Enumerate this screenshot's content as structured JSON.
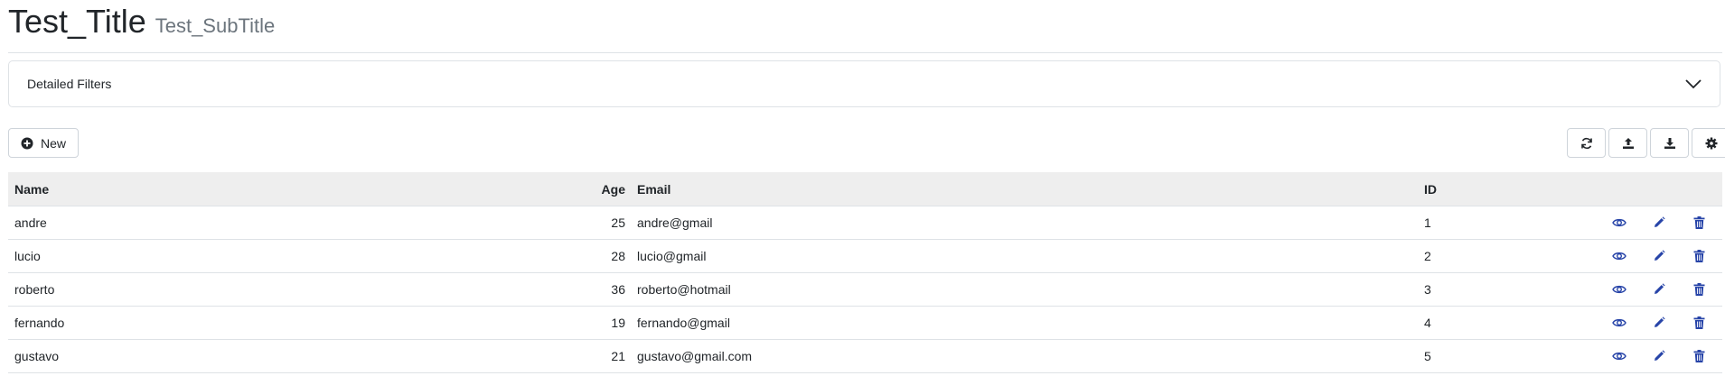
{
  "header": {
    "title": "Test_Title",
    "subtitle": "Test_SubTitle"
  },
  "filters": {
    "label": "Detailed Filters",
    "icon": "chevron-down-icon"
  },
  "toolbar": {
    "new_label": "New",
    "new_icon": "plus-circle-icon",
    "tools": [
      "refresh-icon",
      "upload-icon",
      "download-icon",
      "gear-icon"
    ]
  },
  "table": {
    "columns": [
      "Name",
      "Age",
      "Email",
      "ID"
    ],
    "rows": [
      {
        "name": "andre",
        "age": "25",
        "email": "andre@gmail",
        "id": "1"
      },
      {
        "name": "lucio",
        "age": "28",
        "email": "lucio@gmail",
        "id": "2"
      },
      {
        "name": "roberto",
        "age": "36",
        "email": "roberto@hotmail",
        "id": "3"
      },
      {
        "name": "fernando",
        "age": "19",
        "email": "fernando@gmail",
        "id": "4"
      },
      {
        "name": "gustavo",
        "age": "21",
        "email": "gustavo@gmail.com",
        "id": "5"
      }
    ],
    "row_actions": [
      "eye-icon",
      "pencil-icon",
      "trash-icon"
    ]
  },
  "colors": {
    "accent": "#2744a8",
    "header_bg": "#eeeeee",
    "border": "#dee2e6"
  }
}
